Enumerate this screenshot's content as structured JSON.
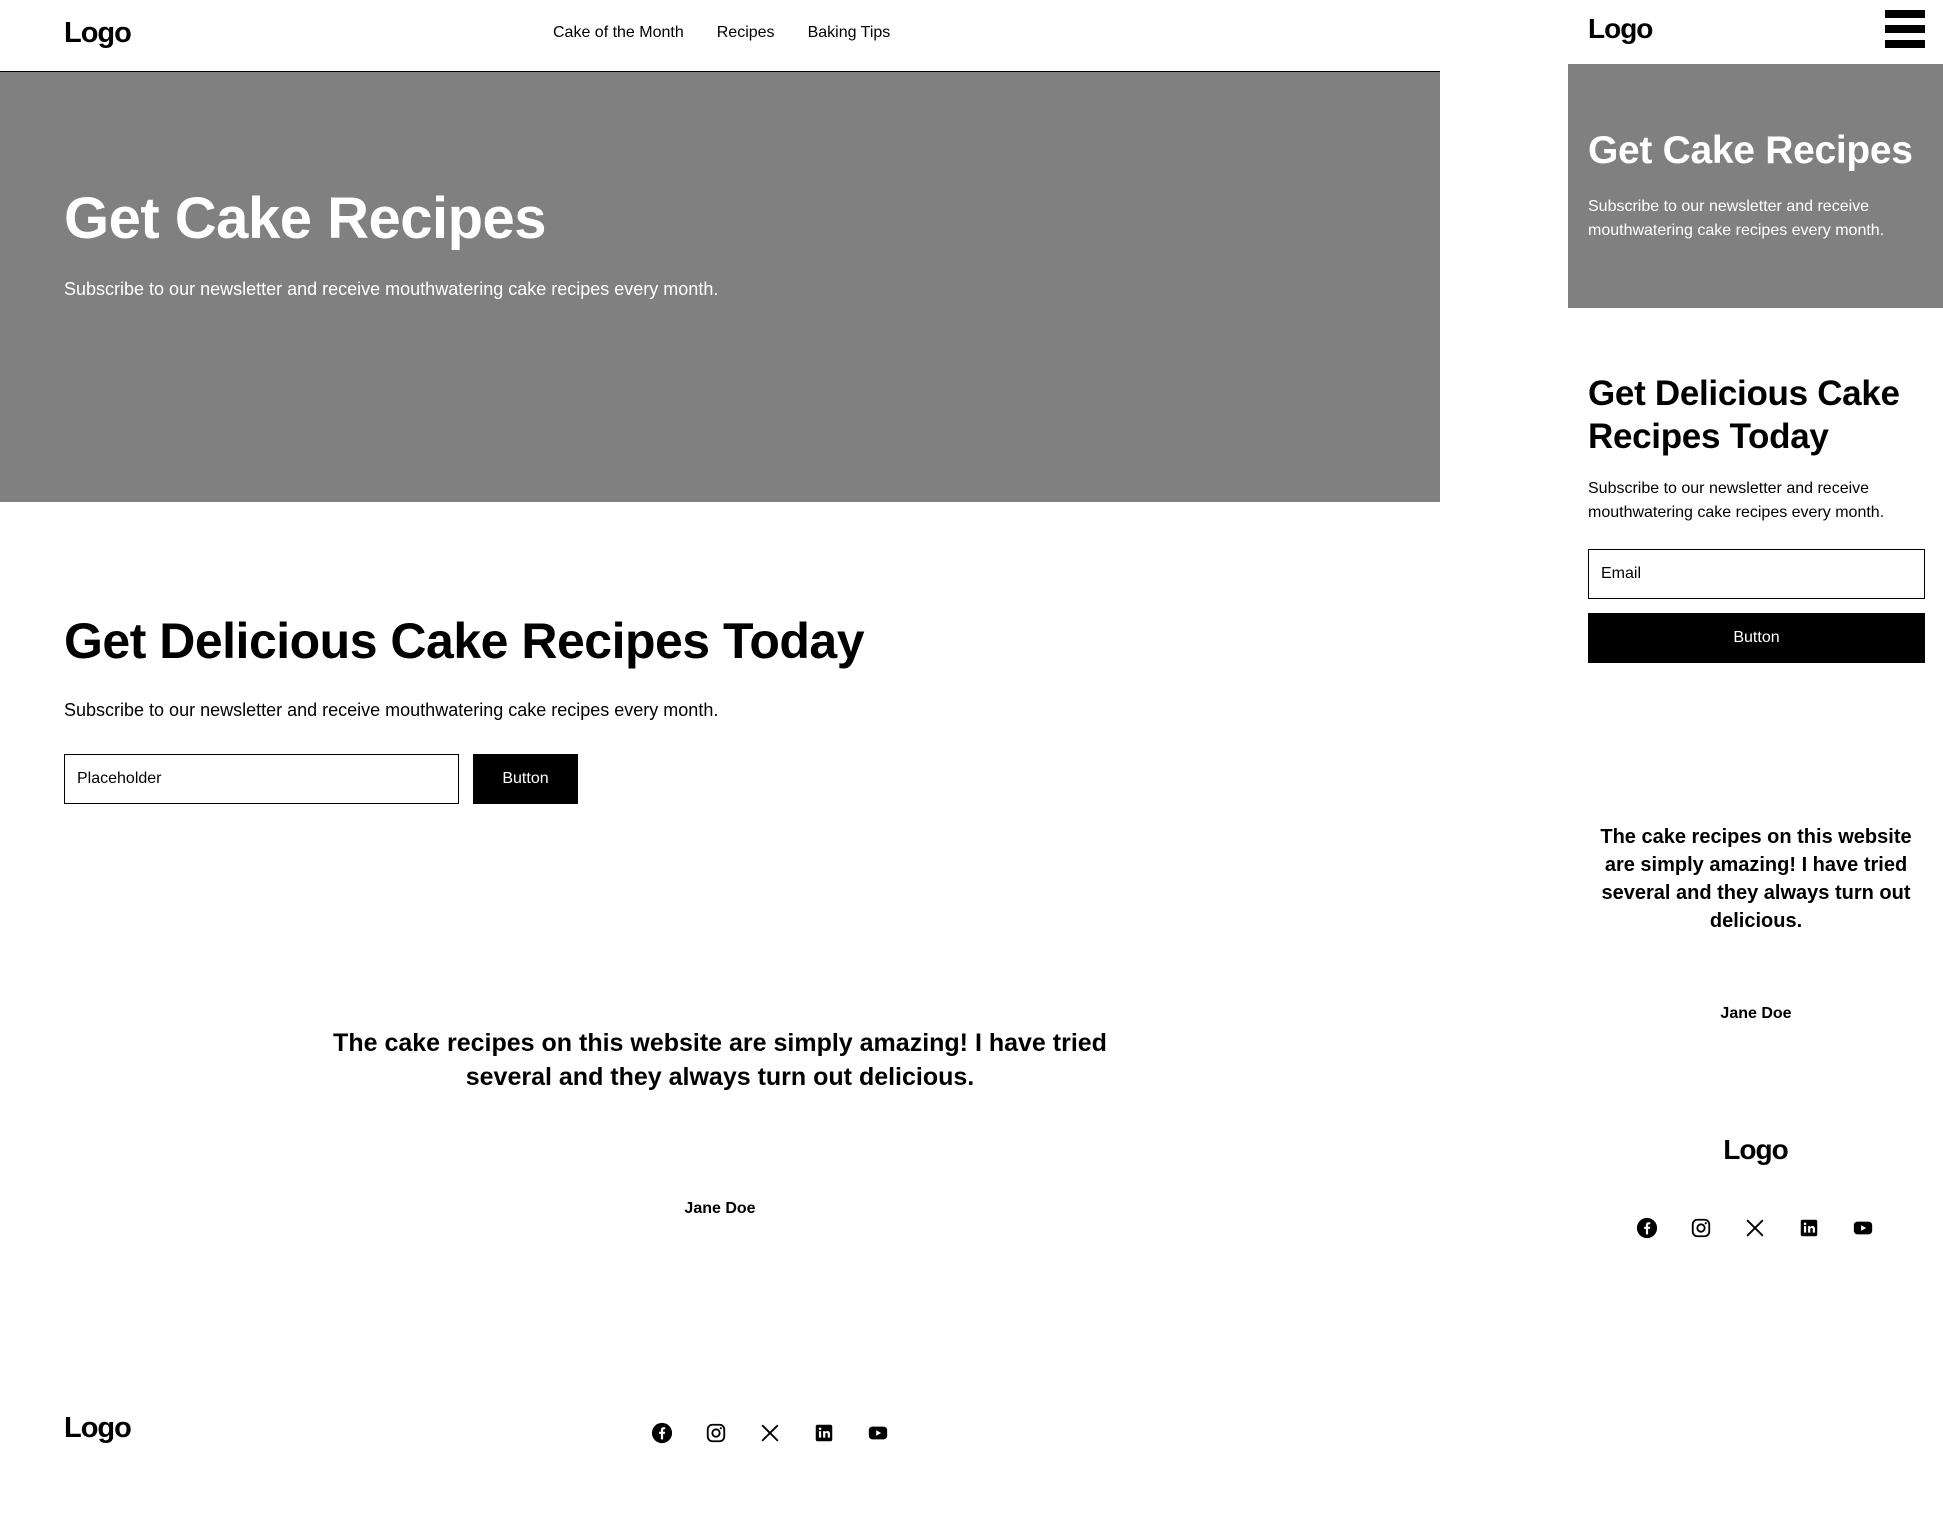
{
  "desktop": {
    "nav": {
      "logo": "Logo",
      "links": [
        "Cake of the Month",
        "Recipes",
        "Baking Tips"
      ]
    },
    "hero": {
      "title": "Get Cake Recipes",
      "subtitle": "Subscribe to our newsletter and receive mouthwatering cake recipes every month."
    },
    "cta": {
      "title": "Get Delicious Cake Recipes Today",
      "subtitle": "Subscribe to our newsletter and receive mouthwatering cake recipes every month.",
      "input_placeholder": "Placeholder",
      "button_label": "Button"
    },
    "testimonial": {
      "quote": "The cake recipes on this website are simply amazing! I have tried several and they always turn out delicious.",
      "author": "Jane Doe"
    },
    "footer": {
      "logo": "Logo",
      "social_icons": [
        "facebook-icon",
        "instagram-icon",
        "x-icon",
        "linkedin-icon",
        "youtube-icon"
      ]
    }
  },
  "mobile": {
    "nav": {
      "logo": "Logo",
      "menu_icon": "hamburger-menu-icon"
    },
    "hero": {
      "title": "Get Cake Recipes",
      "subtitle": "Subscribe to our newsletter and receive mouthwatering cake recipes every month."
    },
    "cta": {
      "title": "Get Delicious Cake Recipes Today",
      "subtitle": "Subscribe to our newsletter and receive mouthwatering cake recipes every month.",
      "input_placeholder": "Email",
      "button_label": "Button"
    },
    "testimonial": {
      "quote": "The cake recipes on this website are simply amazing! I have tried several and they always turn out delicious.",
      "author": "Jane Doe"
    },
    "footer": {
      "logo": "Logo",
      "social_icons": [
        "facebook-icon",
        "instagram-icon",
        "x-icon",
        "linkedin-icon",
        "youtube-icon"
      ]
    }
  },
  "colors": {
    "hero_background": "#808080",
    "primary": "#000000",
    "background": "#ffffff"
  }
}
